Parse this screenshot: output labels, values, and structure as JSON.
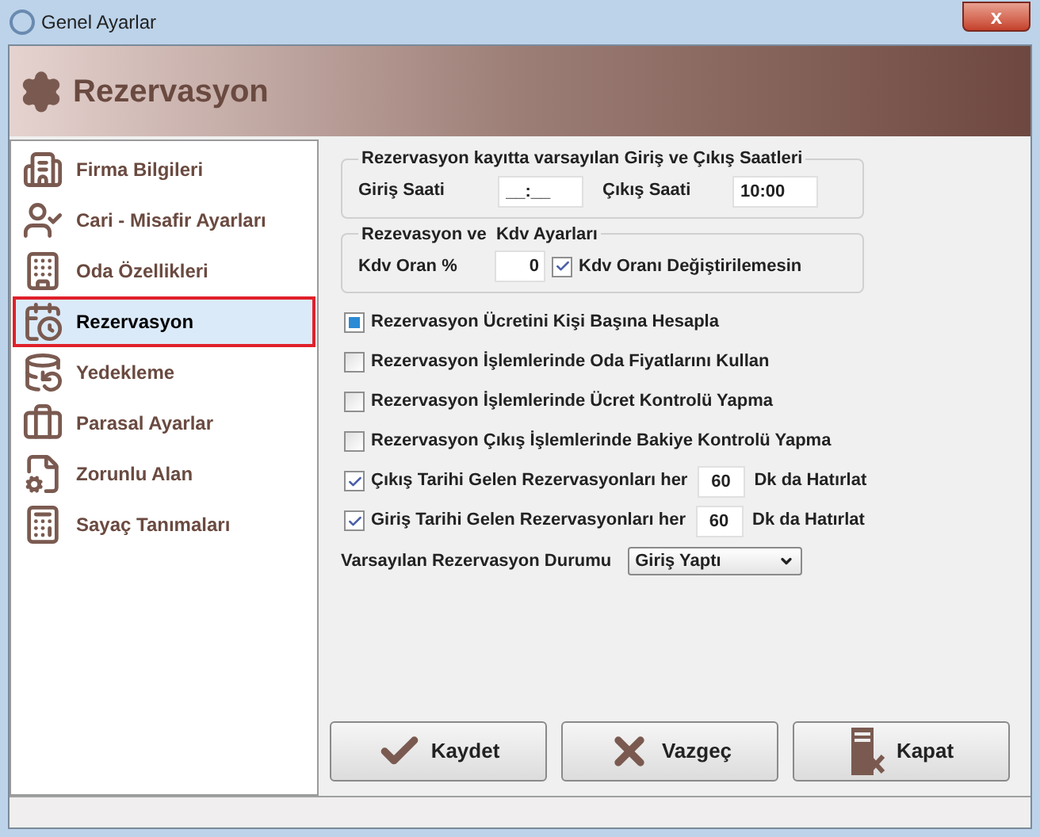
{
  "window": {
    "title": "Genel Ayarlar",
    "close": "x"
  },
  "header": {
    "title": "Rezervasyon"
  },
  "sidebar": {
    "items": [
      {
        "label": "Firma Bilgileri",
        "selected": false
      },
      {
        "label": "Cari - Misafir Ayarları",
        "selected": false
      },
      {
        "label": "Oda Özellikleri",
        "selected": false
      },
      {
        "label": "Rezervasyon",
        "selected": true
      },
      {
        "label": "Yedekleme",
        "selected": false
      },
      {
        "label": "Parasal Ayarlar",
        "selected": false
      },
      {
        "label": "Zorunlu Alan",
        "selected": false
      },
      {
        "label": "Sayaç Tanımaları",
        "selected": false
      }
    ]
  },
  "times_group": {
    "title": "Rezervasyon kayıtta varsayılan Giriş ve Çıkış Saatleri",
    "checkin_label": "Giriş Saati",
    "checkin_value": "__:__",
    "checkout_label": "Çıkış Saati",
    "checkout_value": "10:00"
  },
  "vat_group": {
    "title": "Rezevasyon ve  Kdv Ayarları",
    "rate_label": "Kdv Oran %",
    "rate_value": "0",
    "lock": {
      "label": "Kdv Oranı Değiştirilemesin",
      "checked": true
    }
  },
  "options": [
    {
      "label": "Rezervasyon Ücretini Kişi Başına Hesapla",
      "checked": false,
      "indeterminate": true
    },
    {
      "label": "Rezervasyon İşlemlerinde Oda Fiyatlarını Kullan",
      "checked": false,
      "indeterminate": false
    },
    {
      "label": "Rezervasyon İşlemlerinde Ücret Kontrolü Yapma",
      "checked": false,
      "indeterminate": false
    },
    {
      "label": "Rezervasyon Çıkış İşlemlerinde Bakiye Kontrolü Yapma",
      "checked": false,
      "indeterminate": false
    },
    {
      "label": "Çıkış Tarihi Gelen Rezervasyonları her",
      "checked": true,
      "indeterminate": false,
      "minutes": "60",
      "suffix": "Dk da Hatırlat"
    },
    {
      "label": "Giriş Tarihi Gelen Rezervasyonları her",
      "checked": true,
      "indeterminate": false,
      "minutes": "60",
      "suffix": "Dk da Hatırlat"
    }
  ],
  "default_status": {
    "label": "Varsayılan Rezervasyon Durumu",
    "value": "Giriş Yaptı"
  },
  "buttons": [
    {
      "label": "Kaydet"
    },
    {
      "label": "Vazgeç"
    },
    {
      "label": "Kapat"
    }
  ]
}
